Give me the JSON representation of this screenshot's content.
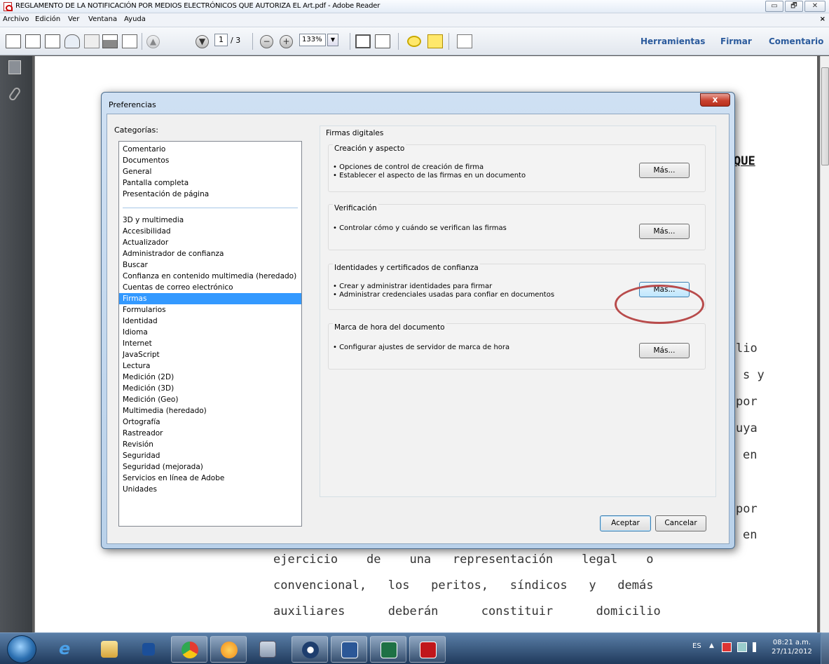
{
  "window": {
    "title": "REGLAMENTO DE LA NOTIFICACIÓN POR MEDIOS ELECTRÓNICOS QUE AUTORIZA EL Art.pdf - Adobe Reader",
    "controls": [
      "▭",
      "🗗",
      "✕"
    ]
  },
  "menu": {
    "items": [
      "Archivo",
      "Edición",
      "Ver",
      "Ventana",
      "Ayuda"
    ],
    "close": "×"
  },
  "toolbar": {
    "page_current": "1",
    "page_total": "/ 3",
    "zoom": "133%",
    "zoom_dd": "▼",
    "up": "▲",
    "down": "▼",
    "zoom_out": "−",
    "zoom_in": "+",
    "tools": "Herramientas",
    "sign": "Firmar",
    "comment": "Comentario"
  },
  "document": {
    "lines": [
      "QUE",
      "lio",
      "s y",
      "por",
      "uya",
      "en",
      "por",
      "en",
      "ejercicio    de    una   representación    legal    o",
      "convencional,   los   peritos,   síndicos   y   demás",
      "auxiliares      deberán      constituir      domicilio"
    ]
  },
  "dialog": {
    "title": "Preferencias",
    "close": "x",
    "categories_label": "Categorías:",
    "categories": [
      "Comentario",
      "Documentos",
      "General",
      "Pantalla completa",
      "Presentación de página",
      "3D y multimedia",
      "Accesibilidad",
      "Actualizador",
      "Administrador de confianza",
      "Buscar",
      "Confianza en contenido multimedia (heredado)",
      "Cuentas de correo electrónico",
      "Firmas",
      "Formularios",
      "Identidad",
      "Idioma",
      "Internet",
      "JavaScript",
      "Lectura",
      "Medición (2D)",
      "Medición (3D)",
      "Medición (Geo)",
      "Multimedia (heredado)",
      "Ortografía",
      "Rastreador",
      "Revisión",
      "Seguridad",
      "Seguridad (mejorada)",
      "Servicios en línea de Adobe",
      "Unidades"
    ],
    "selected_category": "Firmas",
    "panel_title": "Firmas digitales",
    "groups": [
      {
        "title": "Creación y aspecto",
        "lines": [
          "• Opciones de control de creación de firma",
          "• Establecer el aspecto de las firmas en un documento"
        ],
        "button": "Más..."
      },
      {
        "title": "Verificación",
        "lines": [
          "• Controlar cómo y cuándo se verifican las firmas"
        ],
        "button": "Más..."
      },
      {
        "title": "Identidades y certificados de confianza",
        "lines": [
          "• Crear y administrar identidades para firmar",
          "• Administrar credenciales usadas para confiar en documentos"
        ],
        "button": "Más..."
      },
      {
        "title": "Marca de hora del documento",
        "lines": [
          "• Configurar ajustes de servidor de marca de hora"
        ],
        "button": "Más..."
      }
    ],
    "ok": "Aceptar",
    "cancel": "Cancelar"
  },
  "taskbar": {
    "lang": "ES",
    "tray_arrow": "▲",
    "time": "08:21 a.m.",
    "date": "27/11/2012"
  },
  "colors": {
    "accent": "#3399ff",
    "highlight_ring": "#b84b4b",
    "link_blue": "#2a5a9c"
  }
}
